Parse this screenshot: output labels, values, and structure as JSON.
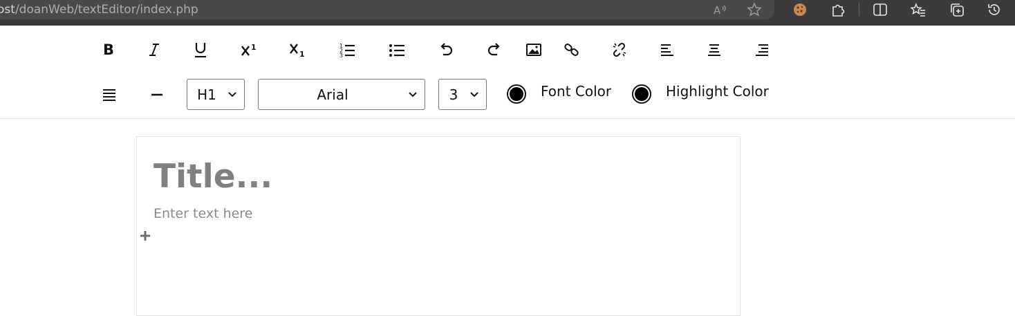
{
  "browser": {
    "url_host": "ost",
    "url_path": "/doanWeb/textEditor/index.php",
    "icons": [
      "read-aloud-icon",
      "favorite-star-icon",
      "cookie-extension-icon",
      "extensions-puzzle-icon",
      "split-screen-icon",
      "favorites-list-icon",
      "collections-icon",
      "history-icon"
    ]
  },
  "toolbar": {
    "heading_select": "H1",
    "font_select": "Arial",
    "size_select": "3",
    "font_color_label": "Font Color",
    "highlight_color_label": "Highlight Color",
    "font_color": "#000000",
    "highlight_color": "#000000"
  },
  "editor": {
    "title_placeholder": "Title...",
    "body_placeholder": "Enter text here"
  }
}
